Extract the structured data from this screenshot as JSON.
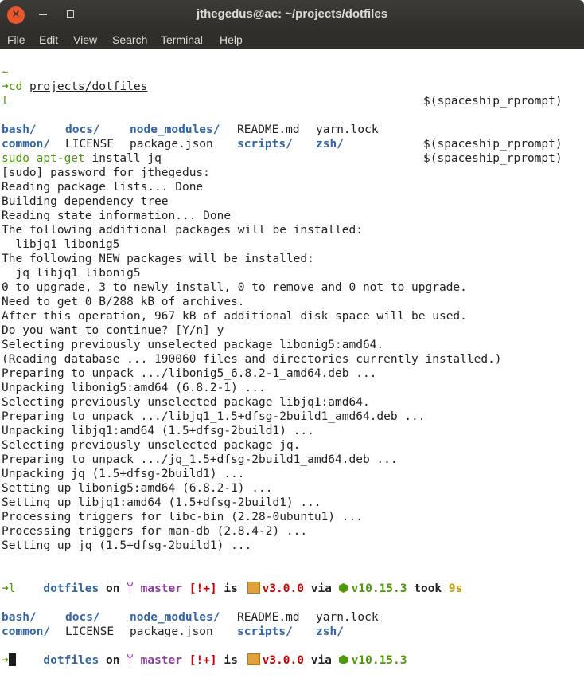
{
  "window": {
    "title": "jthegedus@ac: ~/projects/dotfiles",
    "close": "✕"
  },
  "menu": [
    "File",
    "Edit",
    "View",
    "Search",
    "Terminal",
    "Help"
  ],
  "terminal": {
    "tilde": "~",
    "arrow": "➜",
    "cmd1": {
      "prog": "cd",
      "arg": "projects/dotfiles"
    },
    "l": "l",
    "rprompt": "$(spaceship_rprompt)",
    "ls_row1": [
      "bash/",
      "docs/",
      "node_modules/",
      "README.md",
      "yarn.lock"
    ],
    "ls_row2": [
      "common/",
      "LICENSE",
      "package.json",
      "scripts/",
      "zsh/"
    ],
    "sudo_cmd": {
      "sudo": "sudo",
      "prog": "apt-get",
      "rest": "install jq"
    },
    "output": [
      "[sudo] password for jthegedus:",
      "Reading package lists... Done",
      "Building dependency tree",
      "Reading state information... Done",
      "The following additional packages will be installed:",
      "  libjq1 libonig5",
      "The following NEW packages will be installed:",
      "  jq libjq1 libonig5",
      "0 to upgrade, 3 to newly install, 0 to remove and 0 not to upgrade.",
      "Need to get 0 B/288 kB of archives.",
      "After this operation, 967 kB of additional disk space will be used.",
      "Do you want to continue? [Y/n] y",
      "Selecting previously unselected package libonig5:amd64.",
      "(Reading database ... 190060 files and directories currently installed.)",
      "Preparing to unpack .../libonig5_6.8.2-1_amd64.deb ...",
      "Unpacking libonig5:amd64 (6.8.2-1) ...",
      "Selecting previously unselected package libjq1:amd64.",
      "Preparing to unpack .../libjq1_1.5+dfsg-2build1_amd64.deb ...",
      "Unpacking libjq1:amd64 (1.5+dfsg-2build1) ...",
      "Selecting previously unselected package jq.",
      "Preparing to unpack .../jq_1.5+dfsg-2build1_amd64.deb ...",
      "Unpacking jq (1.5+dfsg-2build1) ...",
      "Setting up libonig5:amd64 (6.8.2-1) ...",
      "Setting up libjq1:amd64 (1.5+dfsg-2build1) ...",
      "Processing triggers for libc-bin (2.28-0ubuntu1) ...",
      "Processing triggers for man-db (2.8.4-2) ...",
      "Setting up jq (1.5+dfsg-2build1) ..."
    ],
    "prompt1": {
      "dir": "dotfiles",
      "on": "on",
      "branch": "master",
      "status": "[!+]",
      "is": "is",
      "version": "v3.0.0",
      "via": "via",
      "node": "v10.15.3",
      "took": "took",
      "duration": "9s"
    },
    "prompt2": {
      "dir": "dotfiles",
      "on": "on",
      "branch": "master",
      "status": "[!+]",
      "is": "is",
      "version": "v3.0.0",
      "via": "via",
      "node": "v10.15.3"
    },
    "icons": {
      "branch": "branch-icon",
      "package": "package-icon",
      "node": "nodejs-icon"
    }
  }
}
